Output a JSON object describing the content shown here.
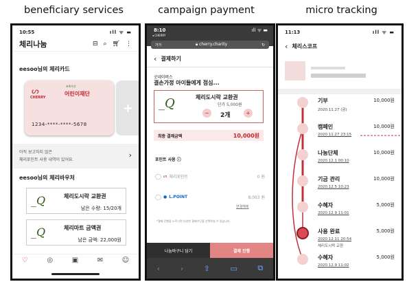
{
  "captions": [
    "beneficiary services",
    "campaign payment",
    "micro tracking"
  ],
  "p1": {
    "time": "10:55",
    "status_icons": "ıll ᯤ ▬",
    "title": "체리나눔",
    "card_section": "eesoo님의 체리카드",
    "card_brand": "CHERRY",
    "card_brand_sub": "Nanum Card",
    "card_partner_small": "초록우산",
    "card_partner": "어린이재단",
    "card_number": "1234-****-****-5678",
    "plus": "+",
    "notice_line1": "아직 보고하지 않은",
    "notice_line2": "체리포인트 사용 내역이 있어요.",
    "voucher_section": "eesoo님의 체리바우처",
    "vouchers": [
      {
        "logo": "_Q",
        "name": "체리도시락 교환권",
        "detail": "남은 수량: 15/20개"
      },
      {
        "logo": "_Q",
        "name": "체리마트 금액권",
        "detail": "남은 금액: 22,000원"
      }
    ]
  },
  "p2": {
    "time": "8:10",
    "time_sub": "◂ CHERRY",
    "status_icons": "ıll ᯤ ▬",
    "url_left": "가가",
    "url": "cherry.charity",
    "back": "‹",
    "title": "결제하기",
    "org": "굿네이버스",
    "campaign": "결손가정 아이들에게 점심...",
    "logo": "_Q",
    "item_name": "체리도시락 교환권",
    "unit_price": "단가 5,000원",
    "minus": "−",
    "qty": "2개",
    "plus": "+",
    "total_label": "최종 결제금액",
    "total": "10,000원",
    "points_label": "포인트 사용",
    "point1_name": "체리포인트",
    "point1_value": "0 원",
    "point2_name": "L.POINT",
    "point2_value": "8,003 원",
    "point2_link": "연결해제",
    "note": "*결제 진행을 누르시면 다양한 결제수단을 선택하실 수 있습니다.",
    "btn_cart": "나눔바구니 담기",
    "btn_pay": "결제 진행",
    "toolbar": [
      "‹",
      "›",
      "⇧",
      "▭",
      "⧉"
    ]
  },
  "p3": {
    "time": "11:13",
    "status_icons": "ıll ᯤ ▬",
    "back": "‹",
    "title": "체리스코프",
    "events": [
      {
        "name": "기부",
        "date": "2020.11.27 (금)",
        "amount": "10,000원"
      },
      {
        "name": "캠페인",
        "date": "2020.11.27 23:15",
        "amount": "10,000원"
      },
      {
        "name": "나눔단체",
        "date": "2020.12.1 00:10",
        "amount": "10,000원"
      },
      {
        "name": "기금 관리",
        "date": "2020.12.5 10:23",
        "amount": "10,000원"
      },
      {
        "name": "수혜자",
        "date": "2020.12.9 11:01",
        "amount": "5,000원"
      },
      {
        "name": "사용 완료",
        "date": "2020.12.11 20:54",
        "sub": "체리도시락 교환",
        "amount": "5,000원"
      },
      {
        "name": "수혜자",
        "date": "2020.12.9 11:02",
        "amount": "5,000원"
      }
    ]
  }
}
